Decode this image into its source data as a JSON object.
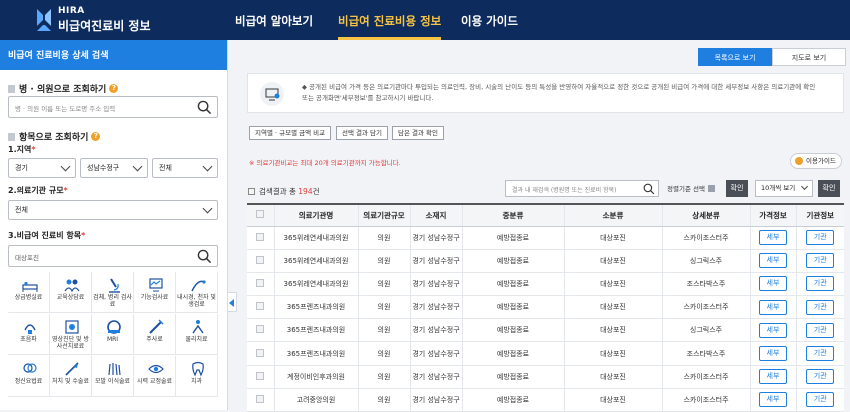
{
  "header": {
    "logo_small": "HIRA",
    "logo_big": "비급여진료비 정보",
    "nav": [
      {
        "label": "비급여 알아보기",
        "active": false
      },
      {
        "label": "비급여 진료비용 정보",
        "active": true
      },
      {
        "label": "이용 가이드",
        "active": false
      }
    ]
  },
  "sidebar": {
    "title": "비급여 진료비용 상세 검색",
    "hospital_search": {
      "heading": "병 · 의원으로 조회하기",
      "placeholder": "병 · 의원 이름 또는 도로명 주소 입력"
    },
    "item_search": {
      "heading": "항목으로 조회하기",
      "region_label": "1.지역",
      "region_selects": [
        "경기",
        "성남수정구",
        "전체"
      ],
      "type_label": "2.의료기관 규모",
      "type_select": "전체",
      "item_label": "3.비급여 진료비 항목",
      "item_value": "대상포진",
      "required_mark": "*"
    },
    "categories": [
      {
        "label": "상급병실료",
        "icon": "bed-icon"
      },
      {
        "label": "교육상담료",
        "icon": "counsel-icon"
      },
      {
        "label": "검체, 병리 검사료",
        "icon": "microscope-icon"
      },
      {
        "label": "기능검사료",
        "icon": "monitor-icon"
      },
      {
        "label": "내시경, 천자 및 생검료",
        "icon": "endoscope-icon"
      },
      {
        "label": "초음파",
        "icon": "ultrasound-icon"
      },
      {
        "label": "영상진단 및 방사선치료료",
        "icon": "radiation-icon"
      },
      {
        "label": "MRI",
        "icon": "mri-icon"
      },
      {
        "label": "주사료",
        "icon": "syringe-icon"
      },
      {
        "label": "물리치료",
        "icon": "physio-icon"
      },
      {
        "label": "정신요법료",
        "icon": "brain-icon"
      },
      {
        "label": "처치 및 수술료",
        "icon": "scalpel-icon"
      },
      {
        "label": "모발 이식술료",
        "icon": "hair-icon"
      },
      {
        "label": "시력 교정술료",
        "icon": "eye-icon"
      },
      {
        "label": "치과",
        "icon": "tooth-icon"
      }
    ]
  },
  "main": {
    "toggle": {
      "list": "목록으로 보기",
      "map": "지도로 보기"
    },
    "notice": "◆ 공개된 비급여 가격 등은 의료기관마다 투입되는 의료인력, 장비, 시술의 난이도 등의 특성을 반영하여 자율적으로 정한 것으로 공개된 비급여 가격에 대한 세부정보 사항은 의료기관에 확인 또는 공개화면'세부정보'를 참고하시기 바랍니다.",
    "chips": [
      "지역별 · 규모별 금액 비교",
      "선택 결과 담기",
      "담은 결과 확인"
    ],
    "warning": "※ 의료기관비교는 최대 20개 의료기관까지 가능합니다.",
    "guide": "이용가이드",
    "result_prefix": "검색결과 총",
    "result_count": "194",
    "result_suffix": "건",
    "result_search_placeholder": "결과 내 재검색 (병원명 또는 진료비 항목)",
    "sort_label": "정렬기준 선택",
    "confirm": "확인",
    "per_page": "10개씩 보기",
    "columns": [
      "",
      "의료기관명",
      "의료기관규모",
      "소재지",
      "중분류",
      "소분류",
      "상세분류",
      "가격정보",
      "기관정보"
    ],
    "rows": [
      [
        "365위레연세내과의원",
        "의원",
        "경기 성남수정구",
        "예방접종료",
        "대상포진",
        "스카이조스터주"
      ],
      [
        "365위레연세내과의원",
        "의원",
        "경기 성남수정구",
        "예방접종료",
        "대상포진",
        "싱그릭스주"
      ],
      [
        "365위레연세내과의원",
        "의원",
        "경기 성남수정구",
        "예방접종료",
        "대상포진",
        "조스타박스주"
      ],
      [
        "365프렌즈내과의원",
        "의원",
        "경기 성남수정구",
        "예방접종료",
        "대상포진",
        "스카이조스터주"
      ],
      [
        "365프렌즈내과의원",
        "의원",
        "경기 성남수정구",
        "예방접종료",
        "대상포진",
        "싱그릭스주"
      ],
      [
        "365프렌즈내과의원",
        "의원",
        "경기 성남수정구",
        "예방접종료",
        "대상포진",
        "조스타박스주"
      ],
      [
        "계정이비인후과의원",
        "의원",
        "경기 성남수정구",
        "예방접종료",
        "대상포진",
        "스카이조스터주"
      ],
      [
        "고려중앙의원",
        "의원",
        "경기 성남수정구",
        "예방접종료",
        "대상포진",
        "스카이조스터주"
      ]
    ],
    "price_btn": "세부",
    "org_btn": "기관"
  }
}
